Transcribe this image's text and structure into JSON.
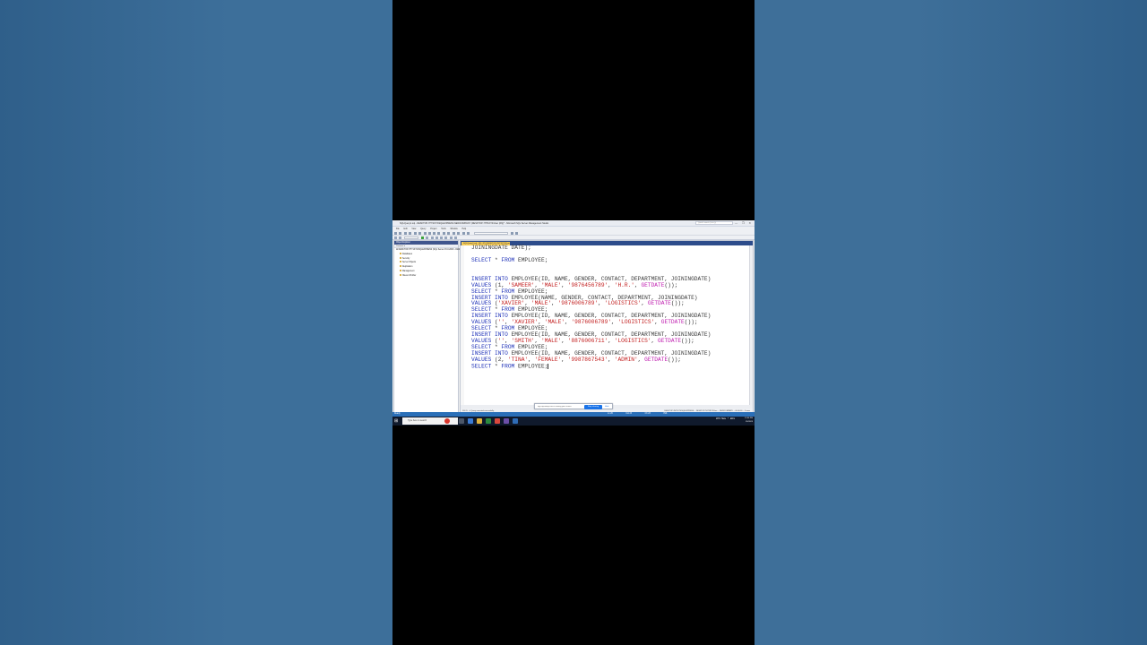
{
  "window": {
    "title": "SQLQuery1.sql - DESKTOP-7HT1KT4\\SQLEXPRESS.NEWCOMPANY (DESKTOP-7HT1KT4\\User (63))* - Microsoft SQL Server Management Studio",
    "quick_launch_placeholder": "Quick Launch (Ctrl+Q)",
    "controls": "— ❐ ✕"
  },
  "menu": [
    "File",
    "Edit",
    "View",
    "Query",
    "Project",
    "Tools",
    "Window",
    "Help"
  ],
  "object_explorer": {
    "title": "Object Explorer",
    "toolbar_label": "Connect ▾",
    "server": "DESKTOP-7HT1KT4\\SQLEXPRESS (SQL Server 15.0.2000 - DESKTOP-7HT1KT4\\User)",
    "nodes": [
      "Databases",
      "Security",
      "Server Objects",
      "Replication",
      "Management",
      "XEvent Profiler"
    ]
  },
  "editor": {
    "tab_label": "SQLQuery1.sql - DE...NY (DESKTOP-7HT1KT4\\User (63))* ✕",
    "lines": [
      [
        {
          "t": "plain",
          "v": "JOININGDATE DATE);"
        }
      ],
      [],
      [
        {
          "t": "kw",
          "v": "SELECT"
        },
        {
          "t": "plain",
          "v": " * "
        },
        {
          "t": "kw",
          "v": "FROM"
        },
        {
          "t": "plain",
          "v": " EMPLOYEE;"
        }
      ],
      [],
      [],
      [
        {
          "t": "kw",
          "v": "INSERT INTO"
        },
        {
          "t": "plain",
          "v": " EMPLOYEE(ID, NAME, GENDER, CONTACT, DEPARTMENT, JOININGDATE)"
        }
      ],
      [
        {
          "t": "kw",
          "v": "VALUES"
        },
        {
          "t": "plain",
          "v": " (1, "
        },
        {
          "t": "str",
          "v": "'SAMEER'"
        },
        {
          "t": "plain",
          "v": ", "
        },
        {
          "t": "str",
          "v": "'MALE'"
        },
        {
          "t": "plain",
          "v": ", "
        },
        {
          "t": "str",
          "v": "'9876456789'"
        },
        {
          "t": "plain",
          "v": ", "
        },
        {
          "t": "str",
          "v": "'H.R.'"
        },
        {
          "t": "plain",
          "v": ", "
        },
        {
          "t": "fn",
          "v": "GETDATE"
        },
        {
          "t": "plain",
          "v": "());"
        }
      ],
      [
        {
          "t": "kw",
          "v": "SELECT"
        },
        {
          "t": "plain",
          "v": " * "
        },
        {
          "t": "kw",
          "v": "FROM"
        },
        {
          "t": "plain",
          "v": " EMPLOYEE;"
        }
      ],
      [
        {
          "t": "kw",
          "v": "INSERT INTO"
        },
        {
          "t": "plain",
          "v": " EMPLOYEE(NAME, GENDER, CONTACT, DEPARTMENT, JOININGDATE)"
        }
      ],
      [
        {
          "t": "kw",
          "v": "VALUES"
        },
        {
          "t": "plain",
          "v": " ("
        },
        {
          "t": "str",
          "v": "'XAVIER'"
        },
        {
          "t": "plain",
          "v": ", "
        },
        {
          "t": "str",
          "v": "'MALE'"
        },
        {
          "t": "plain",
          "v": ", "
        },
        {
          "t": "str",
          "v": "'9876006789'"
        },
        {
          "t": "plain",
          "v": ", "
        },
        {
          "t": "str",
          "v": "'LOGISTICS'"
        },
        {
          "t": "plain",
          "v": ", "
        },
        {
          "t": "fn",
          "v": "GETDATE"
        },
        {
          "t": "plain",
          "v": "());"
        }
      ],
      [
        {
          "t": "kw",
          "v": "SELECT"
        },
        {
          "t": "plain",
          "v": " * "
        },
        {
          "t": "kw",
          "v": "FROM"
        },
        {
          "t": "plain",
          "v": " EMPLOYEE;"
        }
      ],
      [
        {
          "t": "kw",
          "v": "INSERT INTO"
        },
        {
          "t": "plain",
          "v": " EMPLOYEE(ID, NAME, GENDER, CONTACT, DEPARTMENT, JOININGDATE)"
        }
      ],
      [
        {
          "t": "kw",
          "v": "VALUES"
        },
        {
          "t": "plain",
          "v": " ("
        },
        {
          "t": "str",
          "v": "''"
        },
        {
          "t": "plain",
          "v": ", "
        },
        {
          "t": "str",
          "v": "'XAVIER'"
        },
        {
          "t": "plain",
          "v": ", "
        },
        {
          "t": "str",
          "v": "'MALE'"
        },
        {
          "t": "plain",
          "v": ", "
        },
        {
          "t": "str",
          "v": "'9876006789'"
        },
        {
          "t": "plain",
          "v": ", "
        },
        {
          "t": "str",
          "v": "'LOGISTICS'"
        },
        {
          "t": "plain",
          "v": ", "
        },
        {
          "t": "fn",
          "v": "GETDATE"
        },
        {
          "t": "plain",
          "v": "());"
        }
      ],
      [
        {
          "t": "kw",
          "v": "SELECT"
        },
        {
          "t": "plain",
          "v": " * "
        },
        {
          "t": "kw",
          "v": "FROM"
        },
        {
          "t": "plain",
          "v": " EMPLOYEE;"
        }
      ],
      [
        {
          "t": "kw",
          "v": "INSERT INTO"
        },
        {
          "t": "plain",
          "v": " EMPLOYEE(ID, NAME, GENDER, CONTACT, DEPARTMENT, JOININGDATE)"
        }
      ],
      [
        {
          "t": "kw",
          "v": "VALUES"
        },
        {
          "t": "plain",
          "v": " ("
        },
        {
          "t": "str",
          "v": "''"
        },
        {
          "t": "plain",
          "v": ", "
        },
        {
          "t": "str",
          "v": "'SMITH'"
        },
        {
          "t": "plain",
          "v": ", "
        },
        {
          "t": "str",
          "v": "'MALE'"
        },
        {
          "t": "plain",
          "v": ", "
        },
        {
          "t": "str",
          "v": "'8876006711'"
        },
        {
          "t": "plain",
          "v": ", "
        },
        {
          "t": "str",
          "v": "'LOGISTICS'"
        },
        {
          "t": "plain",
          "v": ", "
        },
        {
          "t": "fn",
          "v": "GETDATE"
        },
        {
          "t": "plain",
          "v": "());"
        }
      ],
      [
        {
          "t": "kw",
          "v": "SELECT"
        },
        {
          "t": "plain",
          "v": " * "
        },
        {
          "t": "kw",
          "v": "FROM"
        },
        {
          "t": "plain",
          "v": " EMPLOYEE;"
        }
      ],
      [
        {
          "t": "kw",
          "v": "INSERT INTO"
        },
        {
          "t": "plain",
          "v": " EMPLOYEE(ID, NAME, GENDER, CONTACT, DEPARTMENT, JOININGDATE)"
        }
      ],
      [
        {
          "t": "kw",
          "v": "VALUES"
        },
        {
          "t": "plain",
          "v": " (2, "
        },
        {
          "t": "str",
          "v": "'TINA'"
        },
        {
          "t": "plain",
          "v": ", "
        },
        {
          "t": "str",
          "v": "'FEMALE'"
        },
        {
          "t": "plain",
          "v": ", "
        },
        {
          "t": "str",
          "v": "'9987867543'"
        },
        {
          "t": "plain",
          "v": ", "
        },
        {
          "t": "str",
          "v": "'ADMIN'"
        },
        {
          "t": "plain",
          "v": ", "
        },
        {
          "t": "fn",
          "v": "GETDATE"
        },
        {
          "t": "plain",
          "v": "());"
        }
      ],
      [
        {
          "t": "kw",
          "v": "SELECT"
        },
        {
          "t": "plain",
          "v": " * "
        },
        {
          "t": "kw",
          "v": "FROM"
        },
        {
          "t": "plain",
          "v": " EMPLOYEE;"
        }
      ]
    ],
    "zoom": "100 %",
    "status_left": "✔ Query executed successfully.",
    "status_right": "DESKTOP-7HT1KT4\\SQLEXPRESS ... DESKTOP-7HT1KT4\\User ... NEWCOMPANY ... 00:00:00 ... 0 rows"
  },
  "notification": {
    "message": "app.clipchamp.com is sharing your screen.",
    "stop_label": "Stop sharing",
    "hide_label": "Hide"
  },
  "statusbar": {
    "ready": "Ready",
    "ln": "Ln 26",
    "col": "Col 23",
    "ch": "Ch 23",
    "mode": "INS"
  },
  "taskbar": {
    "search_placeholder": "Type here to search",
    "weather": "29°C Haze",
    "lang": "ENG",
    "time": "12:06 PM",
    "date": "1/5/2023"
  },
  "colors": {
    "accent": "#2a6fb8",
    "tab_active": "#f5cc5b",
    "keyword": "#1f32b8",
    "string": "#c32020",
    "function": "#c020b0"
  }
}
